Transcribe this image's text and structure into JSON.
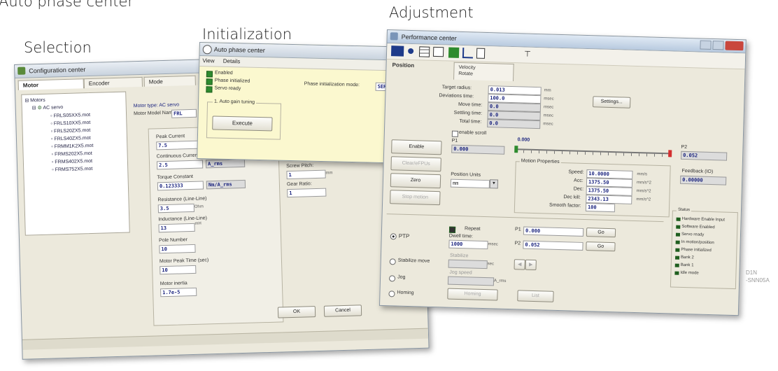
{
  "captions": {
    "auto_phase": "Auto phase center",
    "adjustment": "Adjustment",
    "initialization": "Initialization",
    "selection": "Selection"
  },
  "watermark": {
    "line1": "D1N",
    "line2": "-SNN05A"
  },
  "colors": {
    "accent": "#1a237e",
    "indicator": "#2e8b2e",
    "marker": "#d32f2f",
    "window_bg": "#ece9dc"
  },
  "config_window": {
    "title": "Configuration center",
    "title_icon": "gear-icon",
    "tabs": [
      "Motor",
      "Encoder",
      "Mode"
    ],
    "tree": {
      "root": "Motors",
      "group": "AC servo",
      "items": [
        "FRLS05XX5.mot",
        "FRLS10XX5.mot",
        "FRLS20ZX5.mot",
        "FRLS40ZX5.mot",
        "FRMM1K2X5.mot",
        "FRMS202X5.mot",
        "FRMS402X5.mot",
        "FRMS752X5.mot"
      ]
    },
    "motor_type_label": "Motor type: AC servo",
    "motor_model_label": "Motor Model Name:",
    "motor_model_value": "FRL",
    "params": [
      {
        "label": "Peak Current",
        "value": "7.5",
        "unit": ""
      },
      {
        "label": "Continuous Current",
        "value": "2.5",
        "unit": "A_rms"
      },
      {
        "label": "Torque Constant",
        "value": "0.123333",
        "unit": "Nm/A_rms"
      },
      {
        "label": "Resistance (Line-Line)",
        "value": "3.5",
        "unit": "Ohm"
      },
      {
        "label": "Inductance (Line-Line)",
        "value": "13",
        "unit": "mH"
      },
      {
        "label": "Pole Number",
        "value": "10",
        "unit": ""
      },
      {
        "label": "Motor Peak Time (sec)",
        "value": "10",
        "unit": ""
      },
      {
        "label": "Motor inertia",
        "value": "1.7e-5",
        "unit": ""
      }
    ],
    "screw_pitch_label": "Screw Pitch:",
    "screw_pitch_value": "1",
    "screw_pitch_unit": "mm",
    "gear_ratio_label": "Gear Ratio:",
    "gear_ratio_value": "1",
    "ok_label": "OK",
    "cancel_label": "Cancel"
  },
  "phase_window": {
    "title": "Auto phase center",
    "title_icon": "phase-icon",
    "menu": [
      "View",
      "Details"
    ],
    "checks": [
      "Enabled",
      "Phase initialized",
      "Servo ready"
    ],
    "init_mode_label": "Phase initialization mode:",
    "init_mode_value": "SERVO",
    "gain_group": "1. Auto gain tuning",
    "execute_label": "Execute"
  },
  "perf_window": {
    "title": "Performance center",
    "title_icon": "gauge-icon",
    "toolbar_icons": [
      "motor-icon",
      "dot-icon",
      "grid-icon",
      "monitor-icon",
      "scope-icon",
      "chart-icon",
      "document-icon",
      "pin-icon"
    ],
    "tabs": [
      "Position",
      "Velocity",
      "Rotate"
    ],
    "motion": [
      {
        "label": "Target radius:",
        "value": "0.013",
        "unit": "mm"
      },
      {
        "label": "Deviations time:",
        "value": "100.0",
        "unit": "msec"
      },
      {
        "label": "Move time:",
        "value": "0.0",
        "unit": "msec"
      },
      {
        "label": "Settling time:",
        "value": "0.0",
        "unit": "msec"
      },
      {
        "label": "Total time:",
        "value": "0.0",
        "unit": "msec"
      }
    ],
    "settings_label": "Settings...",
    "enable_label": "Enable",
    "clear_fault_label": "Clear/eFPUs",
    "zero_label": "Zero",
    "stop_label": "Stop motion",
    "enable_scroll_label": "enable scroll",
    "p1_label": "P1",
    "p1_value": "0.000",
    "p2_label": "P2",
    "p2_value": "0.052",
    "slider_value": "0.000",
    "position_units_label": "Position Units",
    "position_units_value": "mm",
    "motion_props_title": "Motion Properties",
    "props": [
      {
        "label": "Speed:",
        "value": "10.0000",
        "unit": "mm/s"
      },
      {
        "label": "Acc:",
        "value": "1375.50",
        "unit": "mm/s^2"
      },
      {
        "label": "Dec:",
        "value": "1375.50",
        "unit": "mm/s^2"
      },
      {
        "label": "Dec kill:",
        "value": "2343.13",
        "unit": "mm/s^2"
      }
    ],
    "smooth_label": "Smooth factor:",
    "smooth_value": "100",
    "feedback_label": "Feedback (IO)",
    "feedback_value": "0.00000",
    "modes": {
      "ptp": "PTP",
      "repeat": "Repeat",
      "dwell_label": "Dwell time:",
      "dwell_value": "1000",
      "dwell_unit": "msec",
      "p1_label": "P1",
      "p1_value": "0.000",
      "p2_label": "P2",
      "p2_value": "0.052",
      "go_label": "Go",
      "stabilize": "Stabilize move",
      "stabilize_sub": "Stabilize",
      "stabilize_unit": "sec",
      "jog": "Jog",
      "jog_sub": "Jog speed",
      "jog_unit": "A_rms",
      "homing": "Homing",
      "homing_btn": "Homing",
      "list_btn": "List"
    },
    "status_title": "Status",
    "status": [
      "Hardware Enable Input",
      "Software Enabled",
      "Servo ready",
      "In motion/position",
      "Phase initialized",
      "Bank 2",
      "Bank 1",
      "Idle mode"
    ]
  }
}
